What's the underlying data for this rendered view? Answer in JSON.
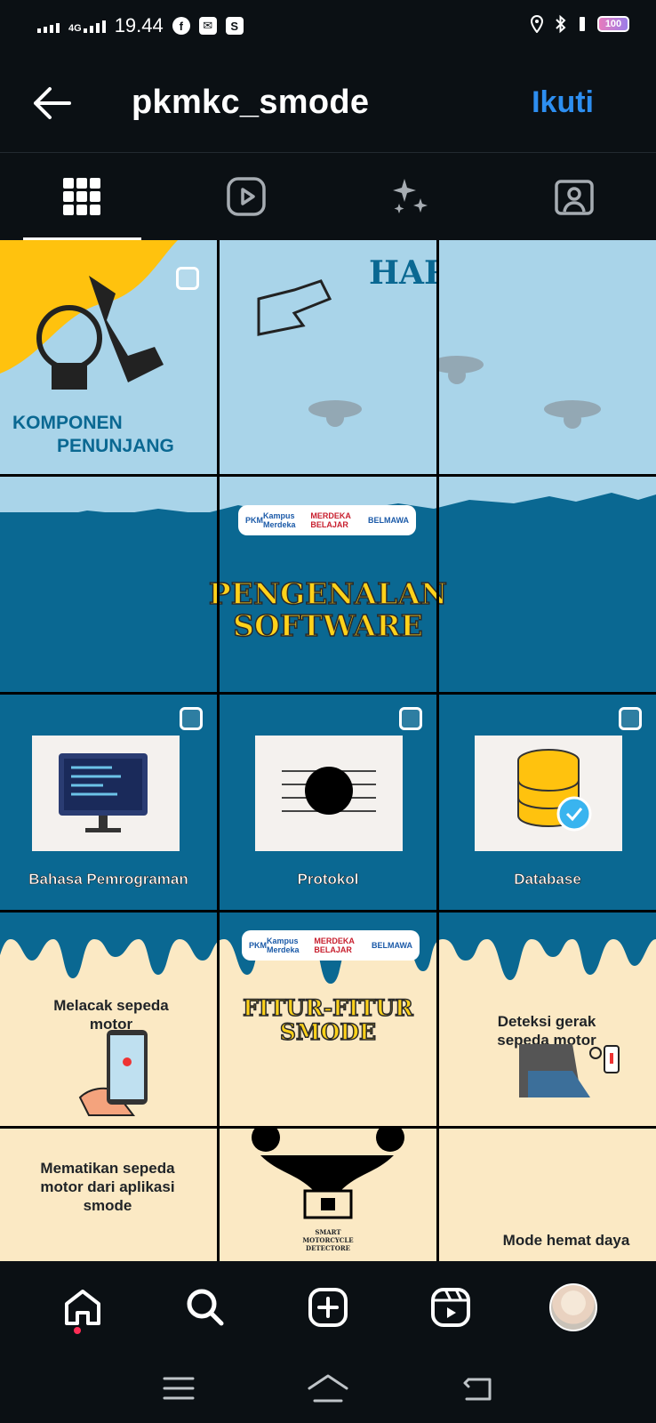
{
  "status_bar": {
    "network": "4G",
    "time": "19.44",
    "battery": "100"
  },
  "header": {
    "username": "pkmkc_smode",
    "follow_label": "Ikuti"
  },
  "tabs": [
    {
      "name": "grid-icon",
      "active": true
    },
    {
      "name": "reels-icon",
      "active": false
    },
    {
      "name": "sparkle-icon",
      "active": false
    },
    {
      "name": "tagged-icon",
      "active": false
    }
  ],
  "posts": {
    "row1": {
      "left_text_1": "KOMPONEN",
      "left_text_2": "PENUNJANG",
      "right_text": "HARDWARE"
    },
    "row2": {
      "title_1": "PENGENALAN",
      "title_2": "SOFTWARE",
      "logos": [
        "PKM",
        "Kampus Merdeka",
        "MERDEKA BELAJAR",
        "BELMAWA"
      ]
    },
    "row3": [
      {
        "label": "Bahasa Pemrograman",
        "icon": "monitor-code-icon"
      },
      {
        "label": "Protokol",
        "icon": "circuit-icon"
      },
      {
        "label": "Database",
        "icon": "database-icon"
      }
    ],
    "row4": {
      "left_text": "Melacak  sepeda motor",
      "title_1": "FITUR-FITUR",
      "title_2": "SMODE",
      "right_text": "Deteksi gerak sepeda motor",
      "logos": [
        "PKM",
        "Kampus Merdeka",
        "MERDEKA BELAJAR",
        "BELMAWA"
      ]
    },
    "row5": {
      "left_text": "Mematikan sepeda motor dari aplikasi smode",
      "center_text": "SMART MOTORCYCLE DETECTORE",
      "right_text": "Mode hemat daya"
    }
  },
  "colors": {
    "accent_blue": "#2d8ef0",
    "tile_dark_blue": "#0a6892",
    "tile_light_blue": "#a9d4e9",
    "tile_yellow": "#ffc20e",
    "tile_cream": "#fbe9c4"
  }
}
